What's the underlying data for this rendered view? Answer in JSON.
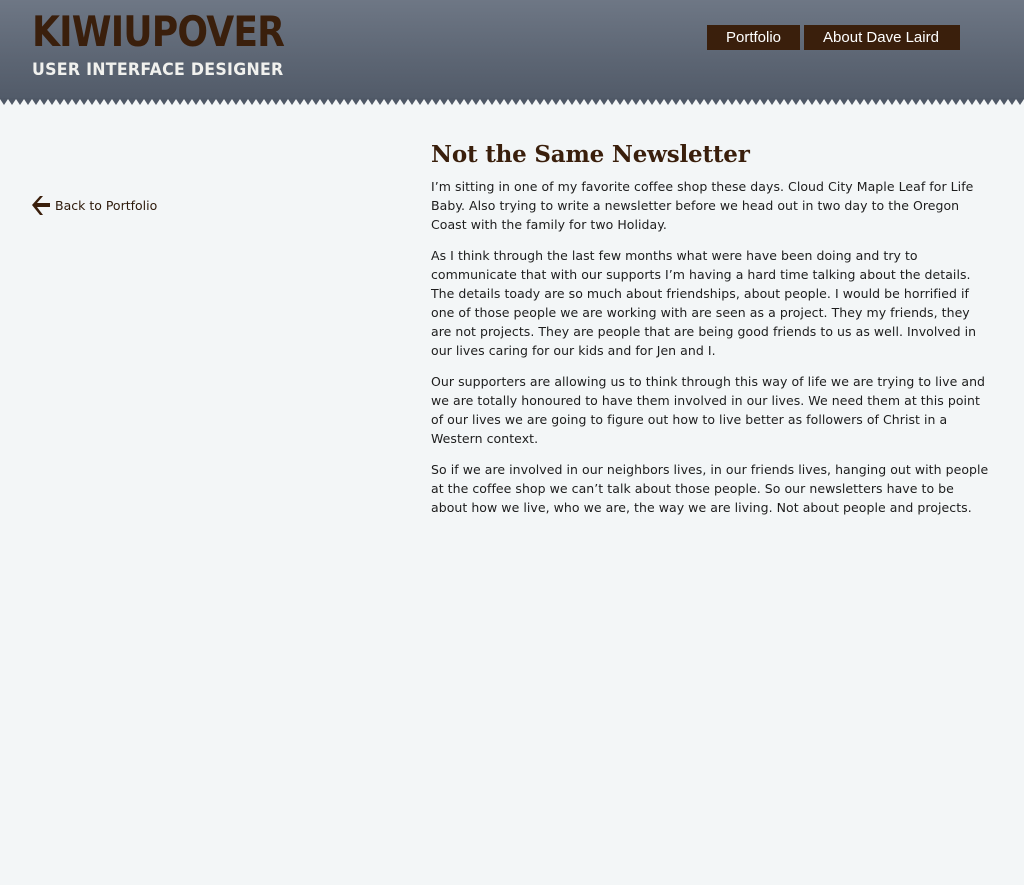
{
  "header": {
    "logo_title": "KIWIUPOVER",
    "logo_subtitle": "USER INTERFACE DESIGNER",
    "nav": {
      "portfolio_label": "Portfolio",
      "about_label": "About Dave Laird"
    },
    "colors": {
      "band": "#5c6573",
      "brand_brown": "#3a1f0c"
    }
  },
  "sidebar": {
    "back_label": "Back to Portfolio",
    "back_icon": "arrow-left-icon"
  },
  "article": {
    "title": "Not the Same Newsletter",
    "paragraphs": [
      "I’m sitting in one of my favorite coffee shop these days. Cloud City Maple Leaf for Life Baby. Also trying to write a newsletter before we head out in two day to the Oregon Coast with the family for two Holiday.",
      "As I think through the last few months what were have been doing and try to communicate that with our supports I’m having a hard time talking about the details. The details toady are so much about friendships, about people. I would be horrified if one of those people we are working with are seen as a project. They my friends, they are not projects. They are people that are being good friends to us as well. Involved in our lives caring for our kids and for Jen and I.",
      "Our supporters are allowing us to think through this way of life we are trying to live and we are totally honoured to have them involved in our lives. We need them at this point of our lives we are going to figure out how to live better as followers of Christ in a Western context.",
      "So if we are involved in our neighbors lives, in our friends lives, hanging out with people at the coffee shop we can’t talk about those people. So our newsletters have to be about how we live, who we are, the way we are living. Not about people and projects."
    ]
  }
}
